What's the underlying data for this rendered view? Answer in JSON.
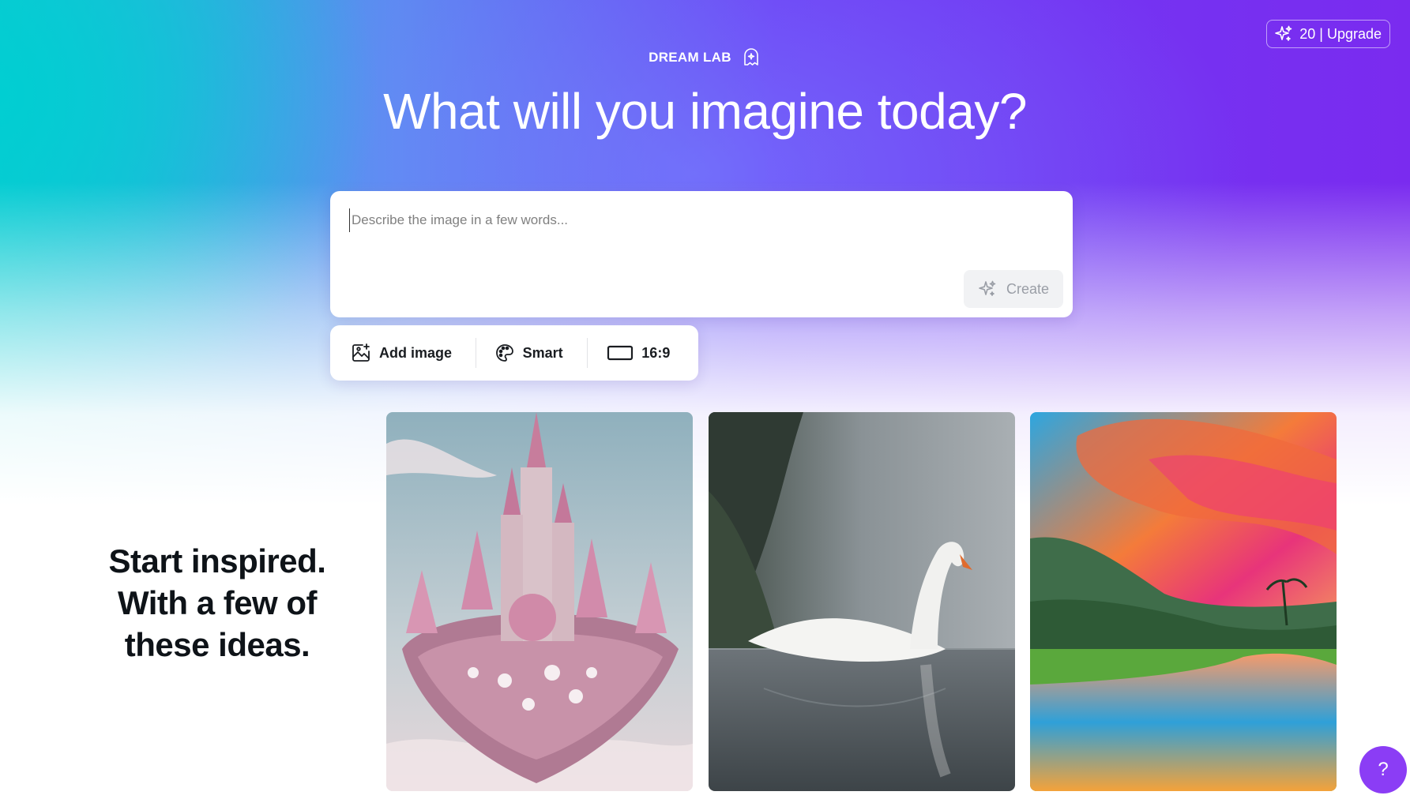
{
  "header": {
    "upgrade_label": "20 | Upgrade",
    "upgrade_icon": "sparkle-icon",
    "brand": "DREAM LAB",
    "brand_icon": "dream-lab-icon",
    "headline": "What will you imagine today?"
  },
  "prompt": {
    "placeholder": "Describe the image in a few words...",
    "value": "",
    "create_label": "Create",
    "create_icon": "sparkle-icon"
  },
  "options": {
    "add_image_label": "Add image",
    "add_image_icon": "add-image-icon",
    "style_label": "Smart",
    "style_icon": "palette-icon",
    "ratio_label": "16:9",
    "ratio_icon": "aspect-ratio-icon"
  },
  "inspiration": {
    "lines": [
      "Start inspired.",
      "With a few of",
      "these ideas."
    ]
  },
  "gallery": [
    {
      "icon": "pink-castle-image"
    },
    {
      "icon": "swan-image"
    },
    {
      "icon": "sunset-river-image"
    }
  ],
  "help": {
    "label": "?"
  },
  "colors": {
    "accent": "#7a2bef",
    "teal": "#12c9d3",
    "help_button": "#8b3df5",
    "text_dark": "#0e1318"
  }
}
